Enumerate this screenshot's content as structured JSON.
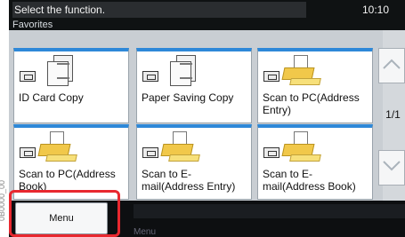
{
  "side_label": "0B0000_00",
  "topbar": {
    "message": "Select the function.",
    "time": "10:10",
    "subtitle": "Favorites"
  },
  "favorites": [
    {
      "label": "ID Card Copy"
    },
    {
      "label": "Paper Saving Copy"
    },
    {
      "label": "Scan to PC(Address Entry)"
    },
    {
      "label": "Scan to PC(Address Book)"
    },
    {
      "label": "Scan to E-mail(Address Entry)"
    },
    {
      "label": "Scan to E-mail(Address Book)"
    }
  ],
  "pagination": {
    "indicator": "1/1"
  },
  "bottombar": {
    "menu_label": "Menu",
    "sub_label": "Menu"
  }
}
